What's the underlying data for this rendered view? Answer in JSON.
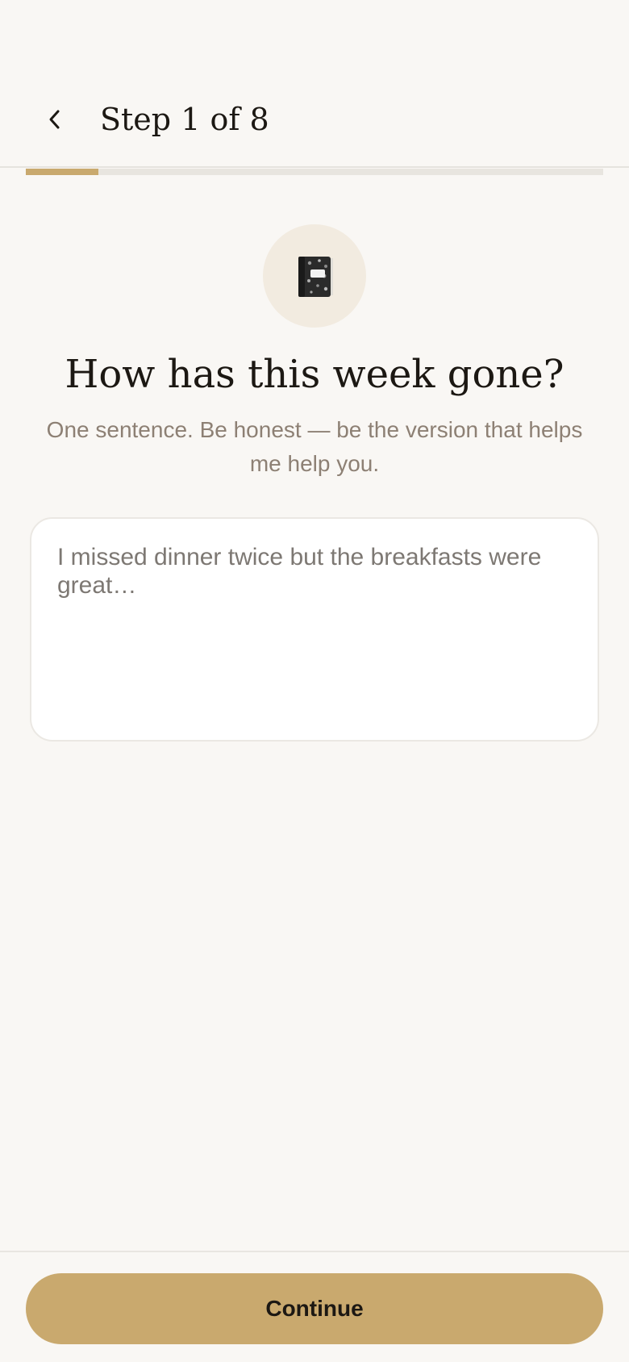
{
  "header": {
    "step_label": "Step 1 of 8",
    "back_icon": "chevron-left-icon"
  },
  "progress": {
    "current_step": 1,
    "total_steps": 8,
    "fraction": 0.125,
    "fill_color": "#c9a96e",
    "track_color": "#e8e5df"
  },
  "prompt": {
    "icon": "notebook-icon",
    "question": "How has this week gone?",
    "subtitle": "One sentence. Be honest — be the version that helps me help you."
  },
  "answer": {
    "value": "",
    "placeholder": "I missed dinner twice but the breakfasts were great…"
  },
  "footer": {
    "continue_label": "Continue",
    "button_color": "#c9a96e"
  }
}
